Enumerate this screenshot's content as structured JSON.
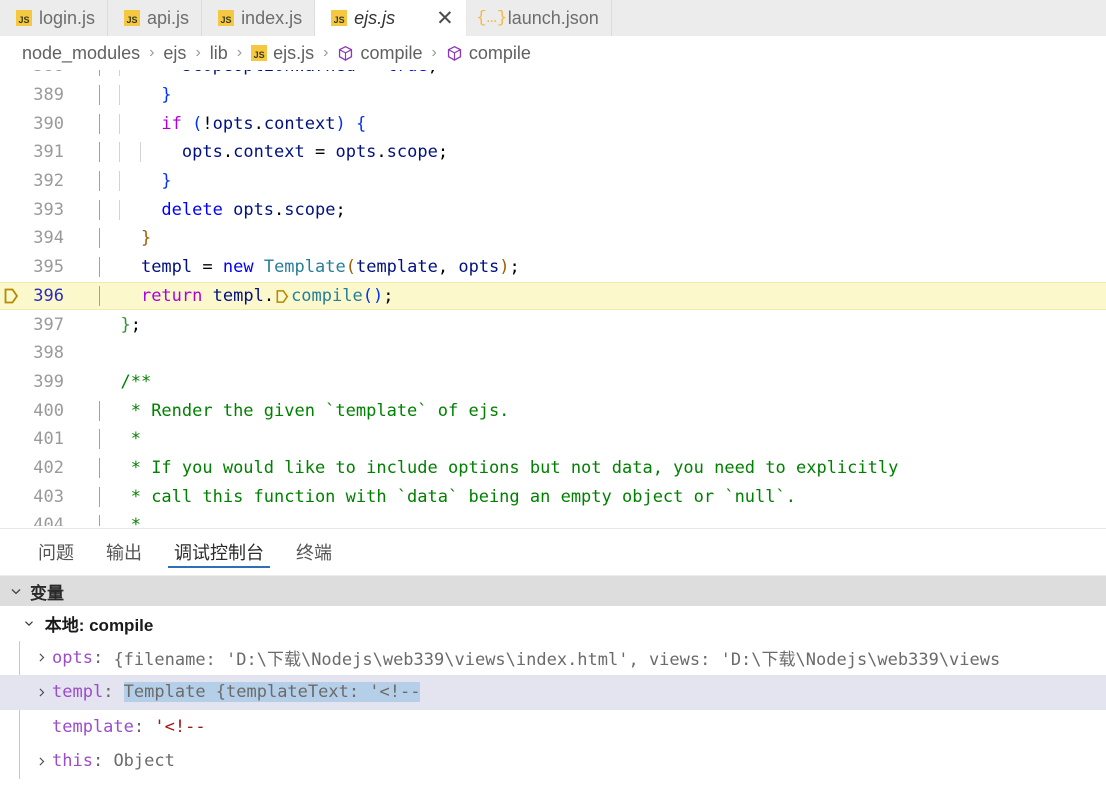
{
  "window": {
    "app": "visual-studio-code",
    "theme": "light"
  },
  "colors": {
    "accent": "#2f6fb5",
    "js_icon": "#f5c842",
    "json_icon": "#f5b942",
    "debug_line_highlight": "#fbf8cc",
    "debug_pointer": "#b58900",
    "selection": "#b5cfe8",
    "focused_row": "#e3e4f0",
    "comment": "#008000",
    "keyword_control": "#af00db",
    "keyword": "#0000ff",
    "identifier": "#001080",
    "class": "#267f99",
    "string": "#a31515"
  },
  "tabs": [
    {
      "label": "login.js",
      "icon": "js-file-icon",
      "active": false,
      "closable": false
    },
    {
      "label": "api.js",
      "icon": "js-file-icon",
      "active": false,
      "closable": false
    },
    {
      "label": "index.js",
      "icon": "js-file-icon",
      "active": false,
      "closable": false
    },
    {
      "label": "ejs.js",
      "icon": "js-file-icon",
      "active": true,
      "closable": true,
      "close_label": "✕"
    },
    {
      "label": "launch.json",
      "icon": "json-file-icon",
      "active": false,
      "closable": false
    }
  ],
  "breadcrumb": {
    "items": [
      {
        "label": "node_modules",
        "icon": null
      },
      {
        "label": "ejs",
        "icon": null
      },
      {
        "label": "lib",
        "icon": null
      },
      {
        "label": "ejs.js",
        "icon": "js-file-icon"
      },
      {
        "label": "compile",
        "icon": "method-symbol-icon"
      },
      {
        "label": "compile",
        "icon": "method-symbol-icon"
      }
    ],
    "separator": "›"
  },
  "editor": {
    "language": "javascript",
    "current_debug_line": 396,
    "first_visible_line": 388,
    "last_visible_line": 404,
    "lines": [
      {
        "num": "388",
        "partial": true,
        "highlight": false,
        "indent_guides": 2,
        "tokens": [
          {
            "t": "        ",
            "c": "plain"
          },
          {
            "t": "scopeOptionWarned",
            "c": "id"
          },
          {
            "t": " = ",
            "c": "plain"
          },
          {
            "t": "true",
            "c": "k-blue"
          },
          {
            "t": ";",
            "c": "plain"
          }
        ]
      },
      {
        "num": "389",
        "partial": false,
        "highlight": false,
        "indent_guides": 2,
        "tokens": [
          {
            "t": "      ",
            "c": "plain"
          },
          {
            "t": "}",
            "c": "br1"
          }
        ]
      },
      {
        "num": "390",
        "partial": false,
        "highlight": false,
        "indent_guides": 2,
        "tokens": [
          {
            "t": "      ",
            "c": "plain"
          },
          {
            "t": "if",
            "c": "k-ctrl"
          },
          {
            "t": " ",
            "c": "plain"
          },
          {
            "t": "(",
            "c": "br1"
          },
          {
            "t": "!",
            "c": "plain"
          },
          {
            "t": "opts",
            "c": "id"
          },
          {
            "t": ".",
            "c": "plain"
          },
          {
            "t": "context",
            "c": "id"
          },
          {
            "t": ")",
            "c": "br1"
          },
          {
            "t": " ",
            "c": "plain"
          },
          {
            "t": "{",
            "c": "br1"
          }
        ]
      },
      {
        "num": "391",
        "partial": false,
        "highlight": false,
        "indent_guides": 3,
        "tokens": [
          {
            "t": "        ",
            "c": "plain"
          },
          {
            "t": "opts",
            "c": "id"
          },
          {
            "t": ".",
            "c": "plain"
          },
          {
            "t": "context",
            "c": "id"
          },
          {
            "t": " = ",
            "c": "plain"
          },
          {
            "t": "opts",
            "c": "id"
          },
          {
            "t": ".",
            "c": "plain"
          },
          {
            "t": "scope",
            "c": "id"
          },
          {
            "t": ";",
            "c": "plain"
          }
        ]
      },
      {
        "num": "392",
        "partial": false,
        "highlight": false,
        "indent_guides": 2,
        "tokens": [
          {
            "t": "      ",
            "c": "plain"
          },
          {
            "t": "}",
            "c": "br1"
          }
        ]
      },
      {
        "num": "393",
        "partial": false,
        "highlight": false,
        "indent_guides": 2,
        "tokens": [
          {
            "t": "      ",
            "c": "plain"
          },
          {
            "t": "delete",
            "c": "k-blue"
          },
          {
            "t": " ",
            "c": "plain"
          },
          {
            "t": "opts",
            "c": "id"
          },
          {
            "t": ".",
            "c": "plain"
          },
          {
            "t": "scope",
            "c": "id"
          },
          {
            "t": ";",
            "c": "plain"
          }
        ]
      },
      {
        "num": "394",
        "partial": false,
        "highlight": false,
        "indent_guides": 1,
        "tokens": [
          {
            "t": "    ",
            "c": "plain"
          },
          {
            "t": "}",
            "c": "br2"
          }
        ]
      },
      {
        "num": "395",
        "partial": false,
        "highlight": false,
        "indent_guides": 1,
        "tokens": [
          {
            "t": "    ",
            "c": "plain"
          },
          {
            "t": "templ",
            "c": "id"
          },
          {
            "t": " = ",
            "c": "plain"
          },
          {
            "t": "new",
            "c": "k-blue"
          },
          {
            "t": " ",
            "c": "plain"
          },
          {
            "t": "Template",
            "c": "cls"
          },
          {
            "t": "(",
            "c": "br2"
          },
          {
            "t": "template",
            "c": "id"
          },
          {
            "t": ", ",
            "c": "plain"
          },
          {
            "t": "opts",
            "c": "id"
          },
          {
            "t": ")",
            "c": "br2"
          },
          {
            "t": ";",
            "c": "plain"
          }
        ]
      },
      {
        "num": "396",
        "partial": false,
        "highlight": true,
        "indent_guides": 1,
        "debug_pointer": true,
        "inline_step_into": true,
        "tokens": [
          {
            "t": "    ",
            "c": "plain"
          },
          {
            "t": "return",
            "c": "k-ctrl"
          },
          {
            "t": " ",
            "c": "plain"
          },
          {
            "t": "templ",
            "c": "id"
          },
          {
            "t": ".",
            "c": "plain"
          },
          {
            "t": "__STEP__",
            "c": "step"
          },
          {
            "t": "compile",
            "c": "cls"
          },
          {
            "t": "(",
            "c": "br1"
          },
          {
            "t": ")",
            "c": "br1"
          },
          {
            "t": ";",
            "c": "plain"
          }
        ]
      },
      {
        "num": "397",
        "partial": false,
        "highlight": false,
        "indent_guides": 0,
        "tokens": [
          {
            "t": "  ",
            "c": "plain"
          },
          {
            "t": "}",
            "c": "br3"
          },
          {
            "t": ";",
            "c": "plain"
          }
        ]
      },
      {
        "num": "398",
        "partial": false,
        "highlight": false,
        "indent_guides": 0,
        "tokens": []
      },
      {
        "num": "399",
        "partial": false,
        "highlight": false,
        "indent_guides": 0,
        "tokens": [
          {
            "t": "  ",
            "c": "plain"
          },
          {
            "t": "/**",
            "c": "cmt"
          }
        ]
      },
      {
        "num": "400",
        "partial": false,
        "highlight": false,
        "indent_guides": 1,
        "tokens": [
          {
            "t": "   ",
            "c": "plain"
          },
          {
            "t": "* Render the given `template` of ejs.",
            "c": "cmt"
          }
        ]
      },
      {
        "num": "401",
        "partial": false,
        "highlight": false,
        "indent_guides": 1,
        "tokens": [
          {
            "t": "   ",
            "c": "plain"
          },
          {
            "t": "*",
            "c": "cmt"
          }
        ]
      },
      {
        "num": "402",
        "partial": false,
        "highlight": false,
        "indent_guides": 1,
        "tokens": [
          {
            "t": "   ",
            "c": "plain"
          },
          {
            "t": "* If you would like to include options but not data, you need to explicitly",
            "c": "cmt"
          }
        ]
      },
      {
        "num": "403",
        "partial": false,
        "highlight": false,
        "indent_guides": 1,
        "tokens": [
          {
            "t": "   ",
            "c": "plain"
          },
          {
            "t": "* call this function with `data` being an empty object or `null`.",
            "c": "cmt"
          }
        ]
      },
      {
        "num": "404",
        "partial": true,
        "highlight": false,
        "indent_guides": 1,
        "tokens": [
          {
            "t": "   ",
            "c": "plain"
          },
          {
            "t": "*",
            "c": "cmt"
          }
        ]
      }
    ]
  },
  "panel": {
    "tabs": [
      {
        "label": "问题",
        "active": false
      },
      {
        "label": "输出",
        "active": false
      },
      {
        "label": "调试控制台",
        "active": true
      },
      {
        "label": "终端",
        "active": false
      }
    ],
    "variables_section": {
      "title": "变量",
      "expanded": true,
      "scope": {
        "label": "本地: compile",
        "expanded": true
      },
      "rows": [
        {
          "name": "opts",
          "separator": ": ",
          "value": "{filename: 'D:\\下载\\Nodejs\\web339\\views\\index.html', views: 'D:\\下载\\Nodejs\\web339\\views",
          "expandable": true,
          "expanded": false,
          "selected": false,
          "value_selected": false,
          "value_kind": "object"
        },
        {
          "name": "templ",
          "separator": ": ",
          "value": "Template {templateText: '<!--",
          "expandable": true,
          "expanded": false,
          "selected": true,
          "value_selected": true,
          "value_kind": "object"
        },
        {
          "name": "template",
          "separator": ": ",
          "value": "'<!--",
          "expandable": false,
          "expanded": false,
          "selected": false,
          "value_selected": false,
          "value_kind": "string"
        },
        {
          "name": "this",
          "separator": ": ",
          "value": "Object",
          "expandable": true,
          "expanded": false,
          "selected": false,
          "value_selected": false,
          "value_kind": "object"
        }
      ]
    }
  }
}
